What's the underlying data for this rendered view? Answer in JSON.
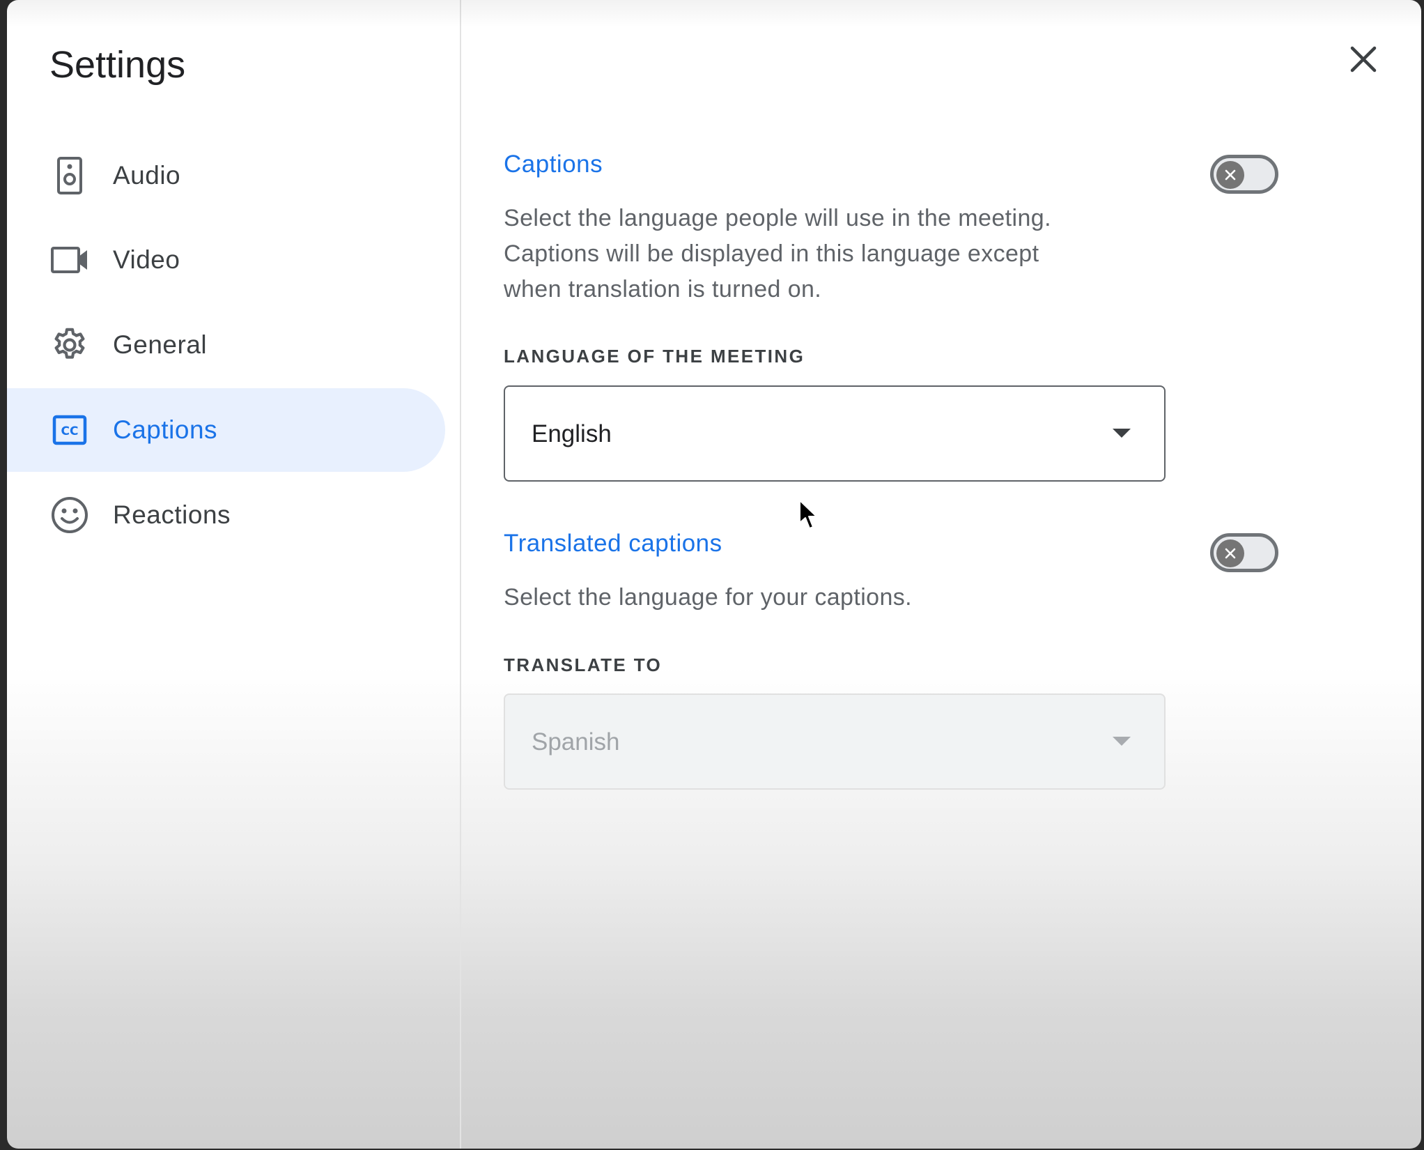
{
  "sidebar": {
    "title": "Settings",
    "items": [
      {
        "label": "Audio",
        "icon": "speaker-icon"
      },
      {
        "label": "Video",
        "icon": "videocam-icon"
      },
      {
        "label": "General",
        "icon": "gear-icon"
      },
      {
        "label": "Captions",
        "icon": "closed-caption-icon",
        "active": true
      },
      {
        "label": "Reactions",
        "icon": "smiley-icon"
      }
    ]
  },
  "main": {
    "captions": {
      "title": "Captions",
      "description": "Select the language people will use in the meeting. Captions will be displayed in this language except when translation is turned on.",
      "enabled": false,
      "field_label": "LANGUAGE OF THE MEETING",
      "selected": "English"
    },
    "translated": {
      "title": "Translated captions",
      "description": "Select the language for your captions.",
      "enabled": false,
      "field_label": "TRANSLATE TO",
      "selected": "Spanish",
      "disabled": true
    }
  },
  "colors": {
    "accent": "#1a73e8",
    "active_bg": "#e8f0fe",
    "text_primary": "#202124",
    "text_secondary": "#5f6368"
  }
}
